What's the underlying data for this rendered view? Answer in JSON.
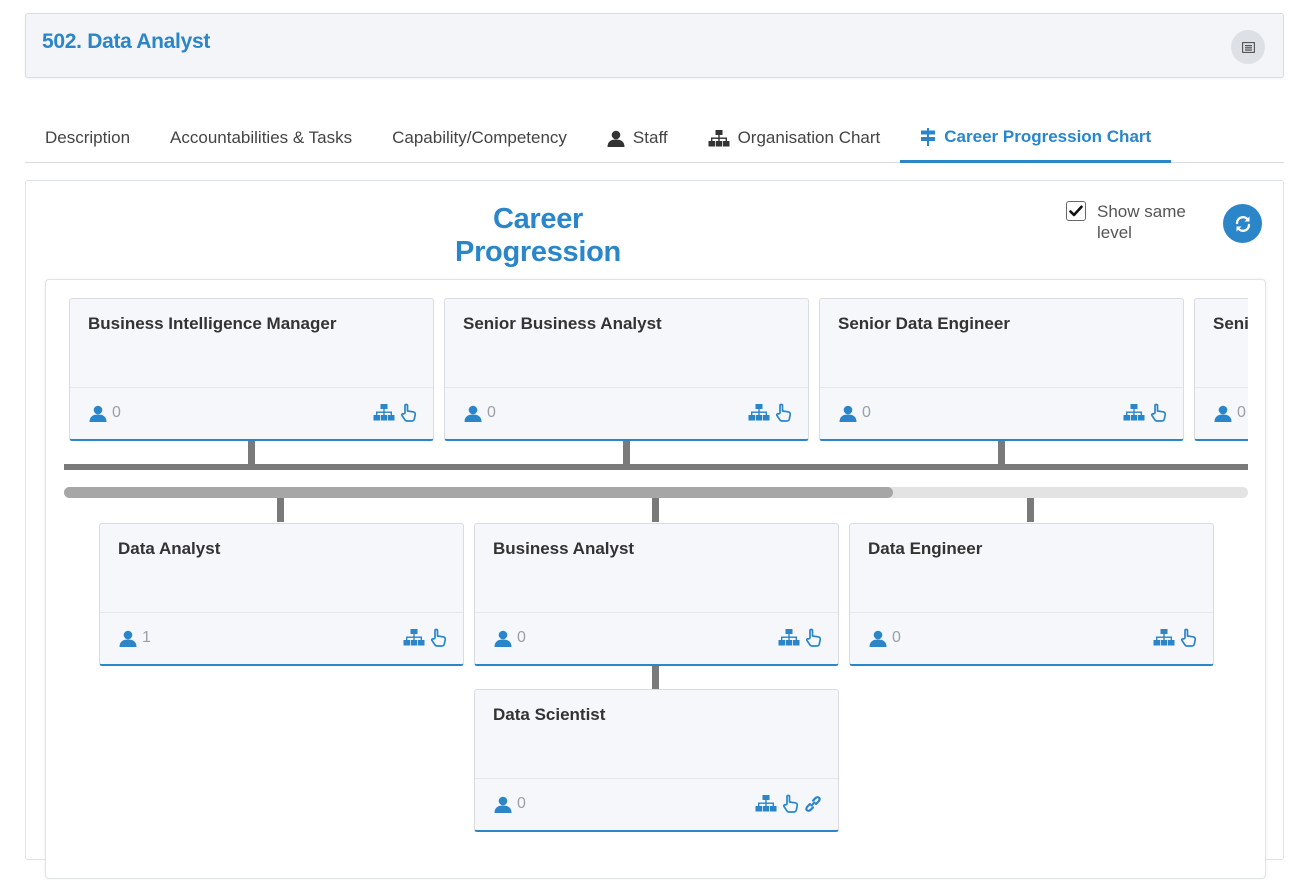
{
  "header": {
    "title": "502. Data Analyst",
    "menu_icon": "menu-icon"
  },
  "tabs": [
    {
      "label": "Description",
      "icon": "",
      "active": false
    },
    {
      "label": "Accountabilities & Tasks",
      "icon": "",
      "active": false
    },
    {
      "label": "Capability/Competency",
      "icon": "",
      "active": false
    },
    {
      "label": "Staff",
      "icon": "user-icon",
      "active": false
    },
    {
      "label": "Organisation Chart",
      "icon": "org-chart-icon",
      "active": false
    },
    {
      "label": "Career Progression Chart",
      "icon": "signpost-icon",
      "active": true
    }
  ],
  "career": {
    "title": "Career Progression",
    "show_same_level_label": "Show same level",
    "show_same_level_checked": true,
    "scroll_fraction": 0.7
  },
  "upper_row": [
    {
      "title": "Business Intelligence Manager",
      "staff": "0"
    },
    {
      "title": "Senior Business Analyst",
      "staff": "0"
    },
    {
      "title": "Senior Data Engineer",
      "staff": "0"
    },
    {
      "title": "Senior",
      "staff": "0"
    }
  ],
  "current_row": [
    {
      "title": "Data Analyst",
      "staff": "1"
    },
    {
      "title": "Business Analyst",
      "staff": "0"
    },
    {
      "title": "Data Engineer",
      "staff": "0"
    }
  ],
  "lower_row": [
    {
      "title": "Data Scientist",
      "staff": "0",
      "linked": true
    }
  ],
  "colors": {
    "accent": "#2a86c9",
    "connector": "#7a7a7a",
    "card_bg": "#f5f7fb"
  }
}
